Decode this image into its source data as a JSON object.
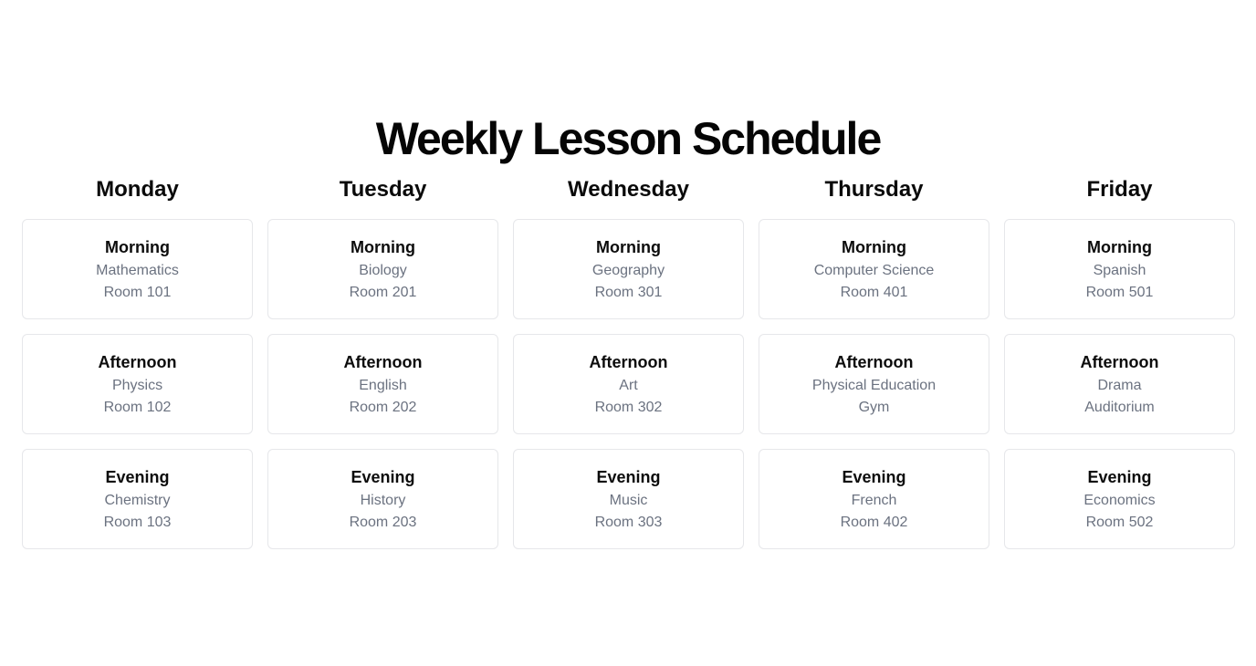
{
  "page": {
    "title": "Weekly Lesson Schedule"
  },
  "days": [
    {
      "name": "Monday",
      "slots": [
        {
          "time": "Morning",
          "subject": "Mathematics",
          "room": "Room 101"
        },
        {
          "time": "Afternoon",
          "subject": "Physics",
          "room": "Room 102"
        },
        {
          "time": "Evening",
          "subject": "Chemistry",
          "room": "Room 103"
        }
      ]
    },
    {
      "name": "Tuesday",
      "slots": [
        {
          "time": "Morning",
          "subject": "Biology",
          "room": "Room 201"
        },
        {
          "time": "Afternoon",
          "subject": "English",
          "room": "Room 202"
        },
        {
          "time": "Evening",
          "subject": "History",
          "room": "Room 203"
        }
      ]
    },
    {
      "name": "Wednesday",
      "slots": [
        {
          "time": "Morning",
          "subject": "Geography",
          "room": "Room 301"
        },
        {
          "time": "Afternoon",
          "subject": "Art",
          "room": "Room 302"
        },
        {
          "time": "Evening",
          "subject": "Music",
          "room": "Room 303"
        }
      ]
    },
    {
      "name": "Thursday",
      "slots": [
        {
          "time": "Morning",
          "subject": "Computer Science",
          "room": "Room 401"
        },
        {
          "time": "Afternoon",
          "subject": "Physical Education",
          "room": "Gym"
        },
        {
          "time": "Evening",
          "subject": "French",
          "room": "Room 402"
        }
      ]
    },
    {
      "name": "Friday",
      "slots": [
        {
          "time": "Morning",
          "subject": "Spanish",
          "room": "Room 501"
        },
        {
          "time": "Afternoon",
          "subject": "Drama",
          "room": "Auditorium"
        },
        {
          "time": "Evening",
          "subject": "Economics",
          "room": "Room 502"
        }
      ]
    }
  ],
  "colors": {
    "text_primary": "#0b0b0b",
    "text_secondary": "#6b7280",
    "card_border": "#e6e7ea",
    "background": "#ffffff"
  }
}
